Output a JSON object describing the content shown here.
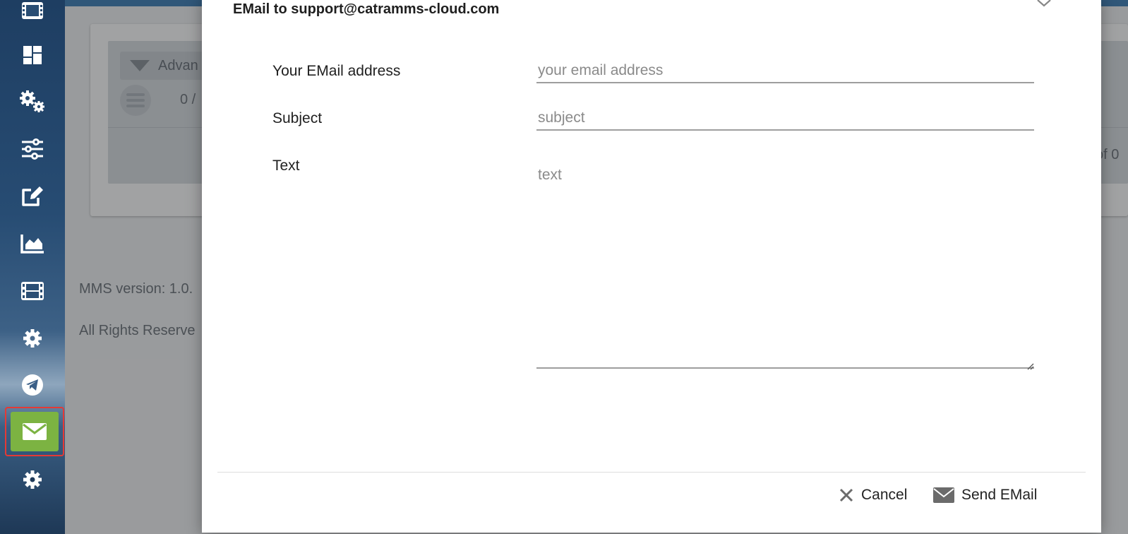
{
  "sidebar": {
    "items": [
      {
        "icon": "film-icon"
      },
      {
        "icon": "dashboard-icon"
      },
      {
        "icon": "cogs-icon"
      },
      {
        "icon": "sliders-icon"
      },
      {
        "icon": "edit-icon"
      },
      {
        "icon": "area-chart-icon"
      },
      {
        "icon": "film-icon"
      },
      {
        "icon": "gear-icon"
      },
      {
        "icon": "telegram-icon"
      },
      {
        "icon": "envelope-icon",
        "active": true
      },
      {
        "icon": "gear-icon"
      }
    ],
    "active_color": "#7cb342",
    "highlight_color": "#e53935"
  },
  "background": {
    "advanced_button_label": "Advan",
    "count_text": "0 /",
    "pager_text": "of 0",
    "version_text": "MMS version: 1.0.",
    "rights_text": "All Rights Reserve"
  },
  "modal": {
    "title": "EMail to support@catramms-cloud.com",
    "email_label": "Your EMail address",
    "email_placeholder": "your email address",
    "subject_label": "Subject",
    "subject_placeholder": "subject",
    "text_label": "Text",
    "text_placeholder": "text",
    "cancel_label": "Cancel",
    "send_label": "Send EMail"
  }
}
